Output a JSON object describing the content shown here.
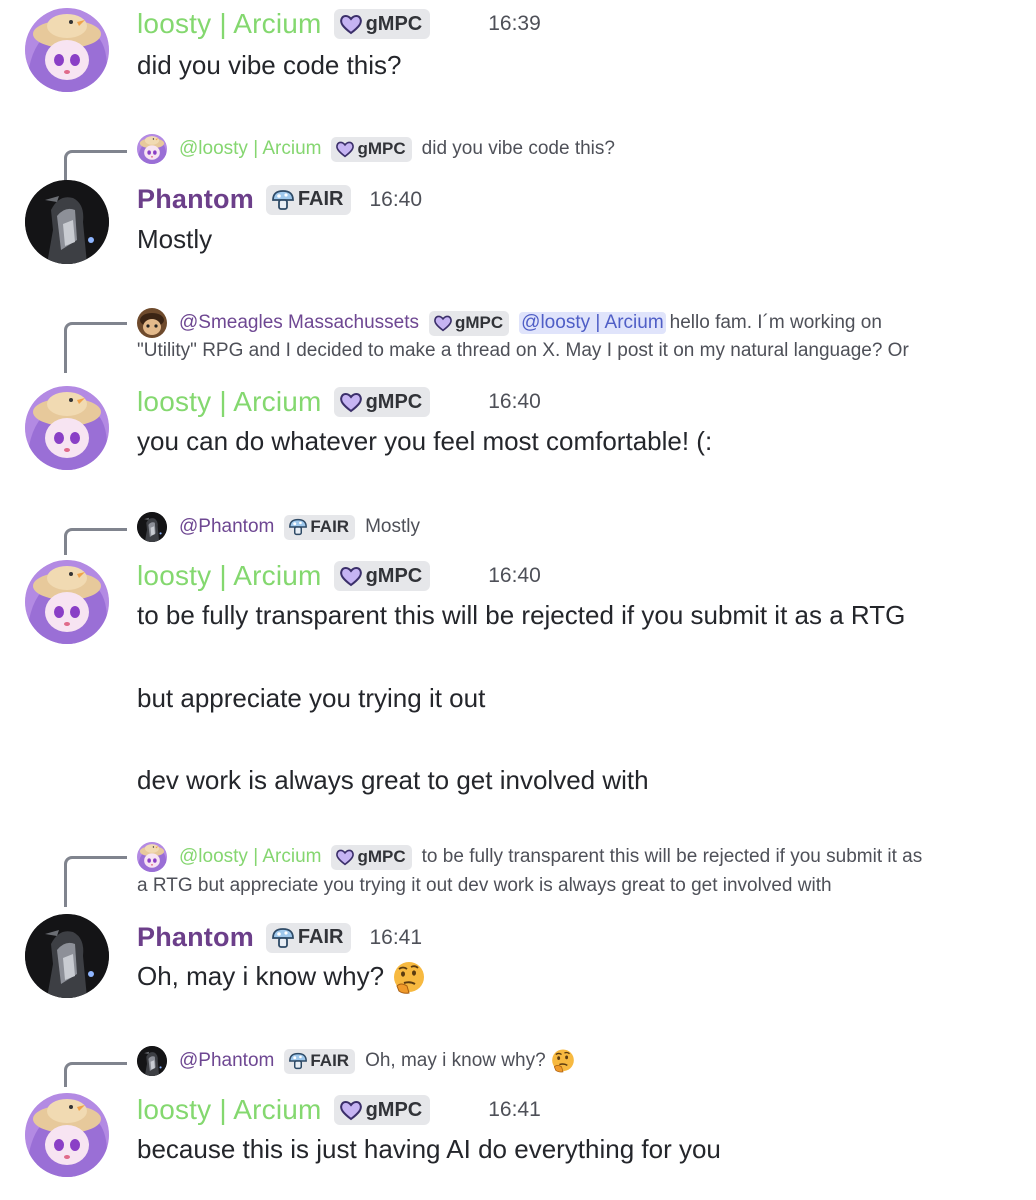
{
  "users": {
    "loosty": {
      "name": "loosty | Arcium",
      "tag": "gMPC",
      "color": "#84d86f"
    },
    "phantom": {
      "name": "Phantom",
      "tag": "FAIR",
      "color": "#6c3f8a"
    }
  },
  "messages": [
    {
      "author": "loosty | Arcium",
      "tag": "gMPC",
      "time": "16:39",
      "lines": [
        "did you vibe code this?"
      ]
    },
    {
      "reply": {
        "name": "@loosty | Arcium",
        "tag": "gMPC",
        "text": "did you vibe code this?"
      },
      "author": "Phantom",
      "tag": "FAIR",
      "time": "16:40",
      "lines": [
        "Mostly"
      ]
    },
    {
      "reply": {
        "name": "@Smeagles Massachussets",
        "tag": "gMPC",
        "mention": "@loosty | Arcium",
        "text": "hello fam. I´m working on",
        "text2": "\"Utility\" RPG and I decided to make a thread on X. May I post it on my natural language? Or"
      },
      "author": "loosty | Arcium",
      "tag": "gMPC",
      "time": "16:40",
      "lines": [
        "you can do whatever you feel most comfortable! (:"
      ]
    },
    {
      "reply": {
        "name": "@Phantom",
        "tag": "FAIR",
        "text": "Mostly"
      },
      "author": "loosty | Arcium",
      "tag": "gMPC",
      "time": "16:40",
      "lines": [
        "to be fully transparent this will be rejected if you submit it as a RTG",
        "but appreciate you trying it out",
        "dev work is always great to get involved with"
      ]
    },
    {
      "reply": {
        "name": "@loosty | Arcium",
        "tag": "gMPC",
        "text": "to be fully transparent this will be rejected if you submit it as",
        "text2": "a RTG  but appreciate you trying it out  dev work is always great to get involved with"
      },
      "author": "Phantom",
      "tag": "FAIR",
      "time": "16:41",
      "lines": [
        "Oh, may i know why?"
      ],
      "emoji": "thinking-face"
    },
    {
      "reply": {
        "name": "@Phantom",
        "tag": "FAIR",
        "text": "Oh, may i know why?",
        "emoji": "thinking-face"
      },
      "author": "loosty | Arcium",
      "tag": "gMPC",
      "time": "16:41",
      "lines": [
        "because this is just having AI do everything for you"
      ]
    }
  ]
}
